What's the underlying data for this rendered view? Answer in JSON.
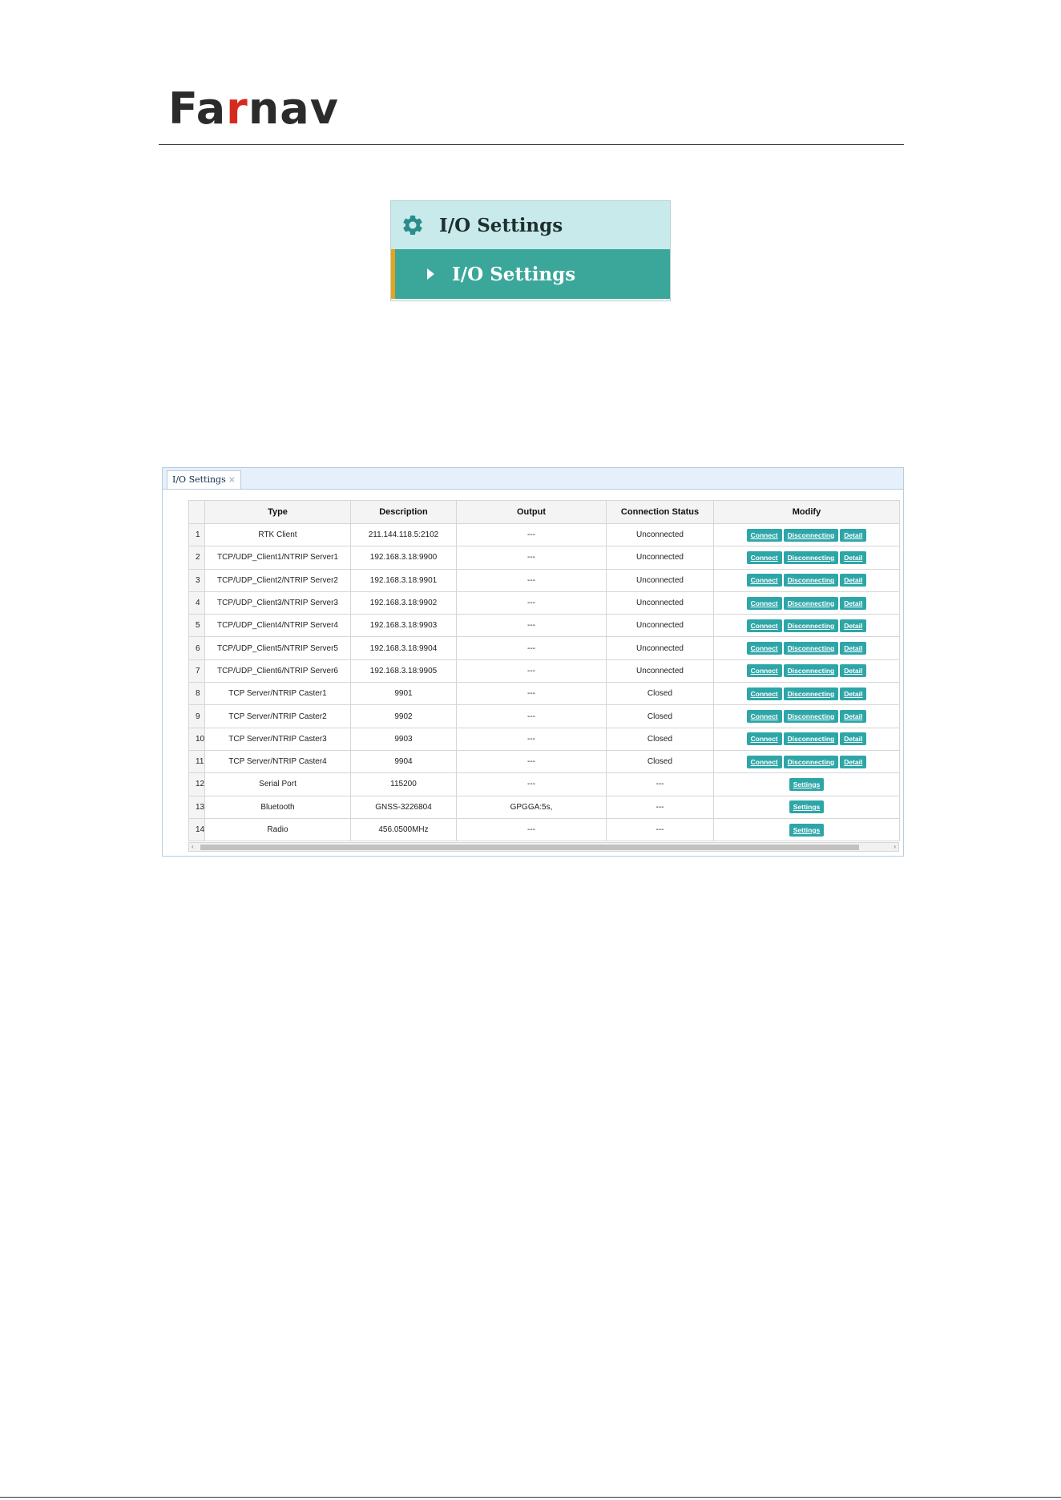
{
  "header": {
    "logo_part1": "Fa",
    "logo_part2": "r",
    "logo_part3": "nav"
  },
  "menu": {
    "header_icon": "gear-icon",
    "header_label": "I/O Settings",
    "item_icon": "caret-right-icon",
    "item_label": "I/O Settings"
  },
  "panel": {
    "tab_label": "I/O Settings",
    "tab_close": "×",
    "columns": [
      "Type",
      "Description",
      "Output",
      "Connection Status",
      "Modify"
    ],
    "rows": [
      {
        "num": "1",
        "type": "RTK Client",
        "description": "211.144.118.5:2102",
        "output": "---",
        "status": "Unconnected",
        "actions": [
          "Connect",
          "Disconnecting",
          "Detail"
        ]
      },
      {
        "num": "2",
        "type": "TCP/UDP_Client1/NTRIP Server1",
        "description": "192.168.3.18:9900",
        "output": "---",
        "status": "Unconnected",
        "actions": [
          "Connect",
          "Disconnecting",
          "Detail"
        ]
      },
      {
        "num": "3",
        "type": "TCP/UDP_Client2/NTRIP Server2",
        "description": "192.168.3.18:9901",
        "output": "---",
        "status": "Unconnected",
        "actions": [
          "Connect",
          "Disconnecting",
          "Detail"
        ]
      },
      {
        "num": "4",
        "type": "TCP/UDP_Client3/NTRIP Server3",
        "description": "192.168.3.18:9902",
        "output": "---",
        "status": "Unconnected",
        "actions": [
          "Connect",
          "Disconnecting",
          "Detail"
        ]
      },
      {
        "num": "5",
        "type": "TCP/UDP_Client4/NTRIP Server4",
        "description": "192.168.3.18:9903",
        "output": "---",
        "status": "Unconnected",
        "actions": [
          "Connect",
          "Disconnecting",
          "Detail"
        ]
      },
      {
        "num": "6",
        "type": "TCP/UDP_Client5/NTRIP Server5",
        "description": "192.168.3.18:9904",
        "output": "---",
        "status": "Unconnected",
        "actions": [
          "Connect",
          "Disconnecting",
          "Detail"
        ]
      },
      {
        "num": "7",
        "type": "TCP/UDP_Client6/NTRIP Server6",
        "description": "192.168.3.18:9905",
        "output": "---",
        "status": "Unconnected",
        "actions": [
          "Connect",
          "Disconnecting",
          "Detail"
        ]
      },
      {
        "num": "8",
        "type": "TCP Server/NTRIP Caster1",
        "description": "9901",
        "output": "---",
        "status": "Closed",
        "actions": [
          "Connect",
          "Disconnecting",
          "Detail"
        ]
      },
      {
        "num": "9",
        "type": "TCP Server/NTRIP Caster2",
        "description": "9902",
        "output": "---",
        "status": "Closed",
        "actions": [
          "Connect",
          "Disconnecting",
          "Detail"
        ]
      },
      {
        "num": "10",
        "type": "TCP Server/NTRIP Caster3",
        "description": "9903",
        "output": "---",
        "status": "Closed",
        "actions": [
          "Connect",
          "Disconnecting",
          "Detail"
        ]
      },
      {
        "num": "11",
        "type": "TCP Server/NTRIP Caster4",
        "description": "9904",
        "output": "---",
        "status": "Closed",
        "actions": [
          "Connect",
          "Disconnecting",
          "Detail"
        ]
      },
      {
        "num": "12",
        "type": "Serial Port",
        "description": "115200",
        "output": "---",
        "status": "---",
        "actions": [
          "Settings"
        ]
      },
      {
        "num": "13",
        "type": "Bluetooth",
        "description": "GNSS-3226804",
        "output": "GPGGA:5s,",
        "status": "---",
        "actions": [
          "Settings"
        ]
      },
      {
        "num": "14",
        "type": "Radio",
        "description": "456.0500MHz",
        "output": "---",
        "status": "---",
        "actions": [
          "Settings"
        ]
      }
    ],
    "scroll_left": "‹",
    "scroll_right": "›"
  },
  "colors": {
    "brand_red": "#d52b1e",
    "menu_head_bg": "#c8eaea",
    "menu_item_bg": "#3aa79a",
    "menu_item_marker": "#e8a317",
    "button_bg": "#2ea6a8"
  }
}
